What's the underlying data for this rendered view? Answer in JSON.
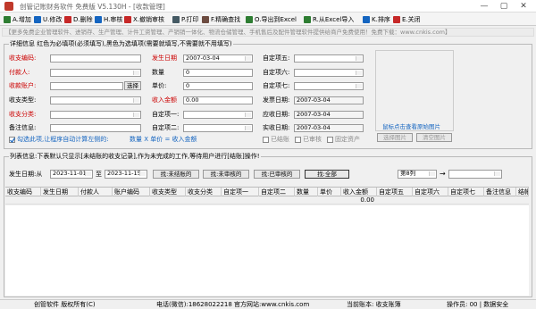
{
  "window": {
    "title": "创管记账财务软件 免费版  V5.130H - [收款管理]",
    "buttons": [
      "—",
      "▢",
      "✕"
    ]
  },
  "toolbar": [
    {
      "label": "A.增加",
      "color": "#2e7d32"
    },
    {
      "label": "U.修改",
      "color": "#1565c0"
    },
    {
      "label": "D.删除",
      "color": "#c62828"
    },
    {
      "label": "H.审核",
      "color": "#1565c0"
    },
    {
      "label": "X.撤销审核",
      "color": "#c62828"
    },
    {
      "label": "P.打印",
      "color": "#455a64"
    },
    {
      "label": "F.精确查找",
      "color": "#6d4c41"
    },
    {
      "label": "O.导出到Excel",
      "color": "#2e7d32"
    },
    {
      "label": "R.从Excel导入",
      "color": "#2e7d32"
    },
    {
      "label": "K.排序",
      "color": "#1565c0"
    },
    {
      "label": "E.关闭",
      "color": "#c62828"
    }
  ],
  "notice": "【更多免费企业管理软件、进销存、生产管理、计件工资管理、产销销一体化、物流仓储管理、手机售后及配件管理软件提供给商户免费使用！免费下载：www.cnkis.com】",
  "detail": {
    "legend": "详细信息 红色为必填项(必须填写),黑色为选填项(需要就填写,不需要就不用填写)",
    "fields": {
      "shouzhi_code": {
        "label": "收支编码:",
        "value": ""
      },
      "fasheng_date": {
        "label": "发生日期",
        "value": "2007-03-04"
      },
      "zidingyi5": {
        "label": "自定项五:",
        "value": ""
      },
      "payer": {
        "label": "付款人:",
        "value": ""
      },
      "quantity": {
        "label": "数量",
        "value": "0"
      },
      "zidingyi6": {
        "label": "自定项六:",
        "value": ""
      },
      "account": {
        "label": "收款账户:",
        "value": "",
        "button": "选择"
      },
      "price": {
        "label": "单价:",
        "value": "0"
      },
      "zidingyi7": {
        "label": "自定项七:",
        "value": ""
      },
      "type": {
        "label": "收支类型:",
        "value": ""
      },
      "amount": {
        "label": "收入金额",
        "value": "0.00"
      },
      "invoice_date": {
        "label": "发票日期:",
        "value": "2007-03-04"
      },
      "category": {
        "label": "收支分类:",
        "value": ""
      },
      "zidingyi1": {
        "label": "自定项一:",
        "value": ""
      },
      "due_date": {
        "label": "应收日期:",
        "value": "2007-03-04"
      },
      "note": {
        "label": "备注信息:",
        "value": ""
      },
      "zidingyi2": {
        "label": "自定项二:",
        "value": ""
      },
      "actual_date": {
        "label": "实收日期:",
        "value": "2007-03-04"
      }
    },
    "checks": [
      "已结账",
      "已审核",
      "固定资产"
    ],
    "auto_calc_label": "勾选此项,让程序自动计算左侧的:",
    "formula": "数量 X 单价 = 收入金额",
    "image_hint": "鼠标点击查看原始图片",
    "image_buttons": [
      "选择图片",
      "清空图片"
    ]
  },
  "list": {
    "legend": "列表信息:下表默认只显示[未结账的收支记录],作为未完成的工作,等待用户进行[结账]操作!",
    "date_label": "发生日期:从",
    "date_from": "2023-11-01",
    "date_to_label": "至",
    "date_to": "2023-11-15",
    "filters": [
      "找:未结账的",
      "找:未审核的",
      "找:已审核的",
      "找:全部"
    ],
    "column_select": "第8列",
    "arrow": "→",
    "headers": [
      "收支编码",
      "发生日期",
      "付款人",
      "账户编码",
      "收支类型",
      "收支分类",
      "自定项一",
      "自定项二",
      "数量",
      "单价",
      "收入金额",
      "自定项五",
      "自定项六",
      "自定项七",
      "备注信息",
      "结帐"
    ],
    "summary_amount": "0.00"
  },
  "status": {
    "left": "创管软件 版权所有(C)",
    "phone": "电话(微信):18628022218 官方网站:www.cnkis.com",
    "user": "当前账本: 收支账簿",
    "operator": "操作员: 00 | 数据安全"
  }
}
